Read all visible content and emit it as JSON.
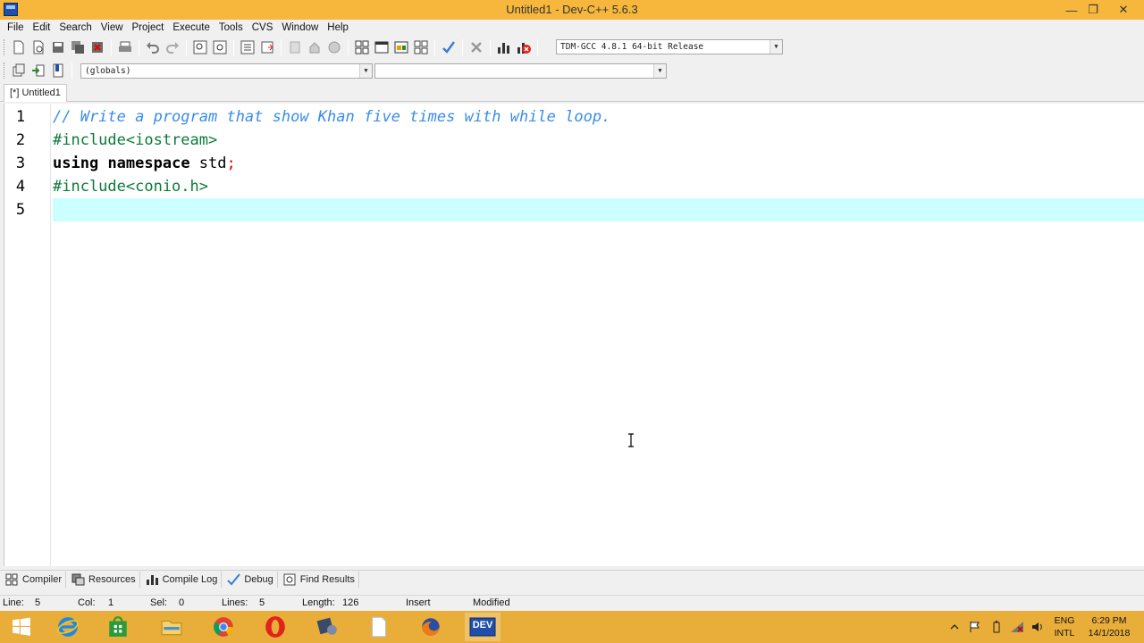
{
  "window": {
    "title": "Untitled1 - Dev-C++ 5.6.3",
    "minimize_glyph": "—",
    "maximize_glyph": "❐",
    "close_glyph": "✕"
  },
  "menu": [
    "File",
    "Edit",
    "Search",
    "View",
    "Project",
    "Execute",
    "Tools",
    "CVS",
    "Window",
    "Help"
  ],
  "toolbar": {
    "compiler_select": "TDM-GCC 4.8.1 64-bit Release",
    "scope_select": "(globals)",
    "member_select": ""
  },
  "editor_tab": {
    "label": "[*] Untitled1"
  },
  "editor": {
    "line_numbers": [
      "1",
      "2",
      "3",
      "4",
      "5"
    ],
    "lines": [
      {
        "comment": "// Write a program that show Khan five times with while loop."
      },
      {
        "pp": "#include<iostream>"
      },
      {
        "kw1": "using",
        "space1": " ",
        "kw2": "namespace",
        "rest": " std",
        "sym": ";"
      },
      {
        "pp": "#include<conio.h>"
      },
      {
        "text": ""
      }
    ],
    "active_line_color": "#ccffff"
  },
  "bottom_tabs": [
    "Compiler",
    "Resources",
    "Compile Log",
    "Debug",
    "Find Results"
  ],
  "status": {
    "line_label": "Line:",
    "line_value": "5",
    "col_label": "Col:",
    "col_value": "1",
    "sel_label": "Sel:",
    "sel_value": "0",
    "lines_label": "Lines:",
    "lines_value": "5",
    "length_label": "Length:",
    "length_value": "126",
    "mode": "Insert",
    "state": "Modified"
  },
  "taskbar": {
    "lang_top": "ENG",
    "lang_bottom": "INTL",
    "time": "6:29 PM",
    "date": "14/1/2018",
    "dev_label": "DEV"
  },
  "colors": {
    "titlebar": "#f6b73c",
    "taskbar": "#e9ae3a",
    "comment": "#3a8ce8",
    "preprocessor": "#0a7a3a",
    "symbol": "#e00000"
  }
}
